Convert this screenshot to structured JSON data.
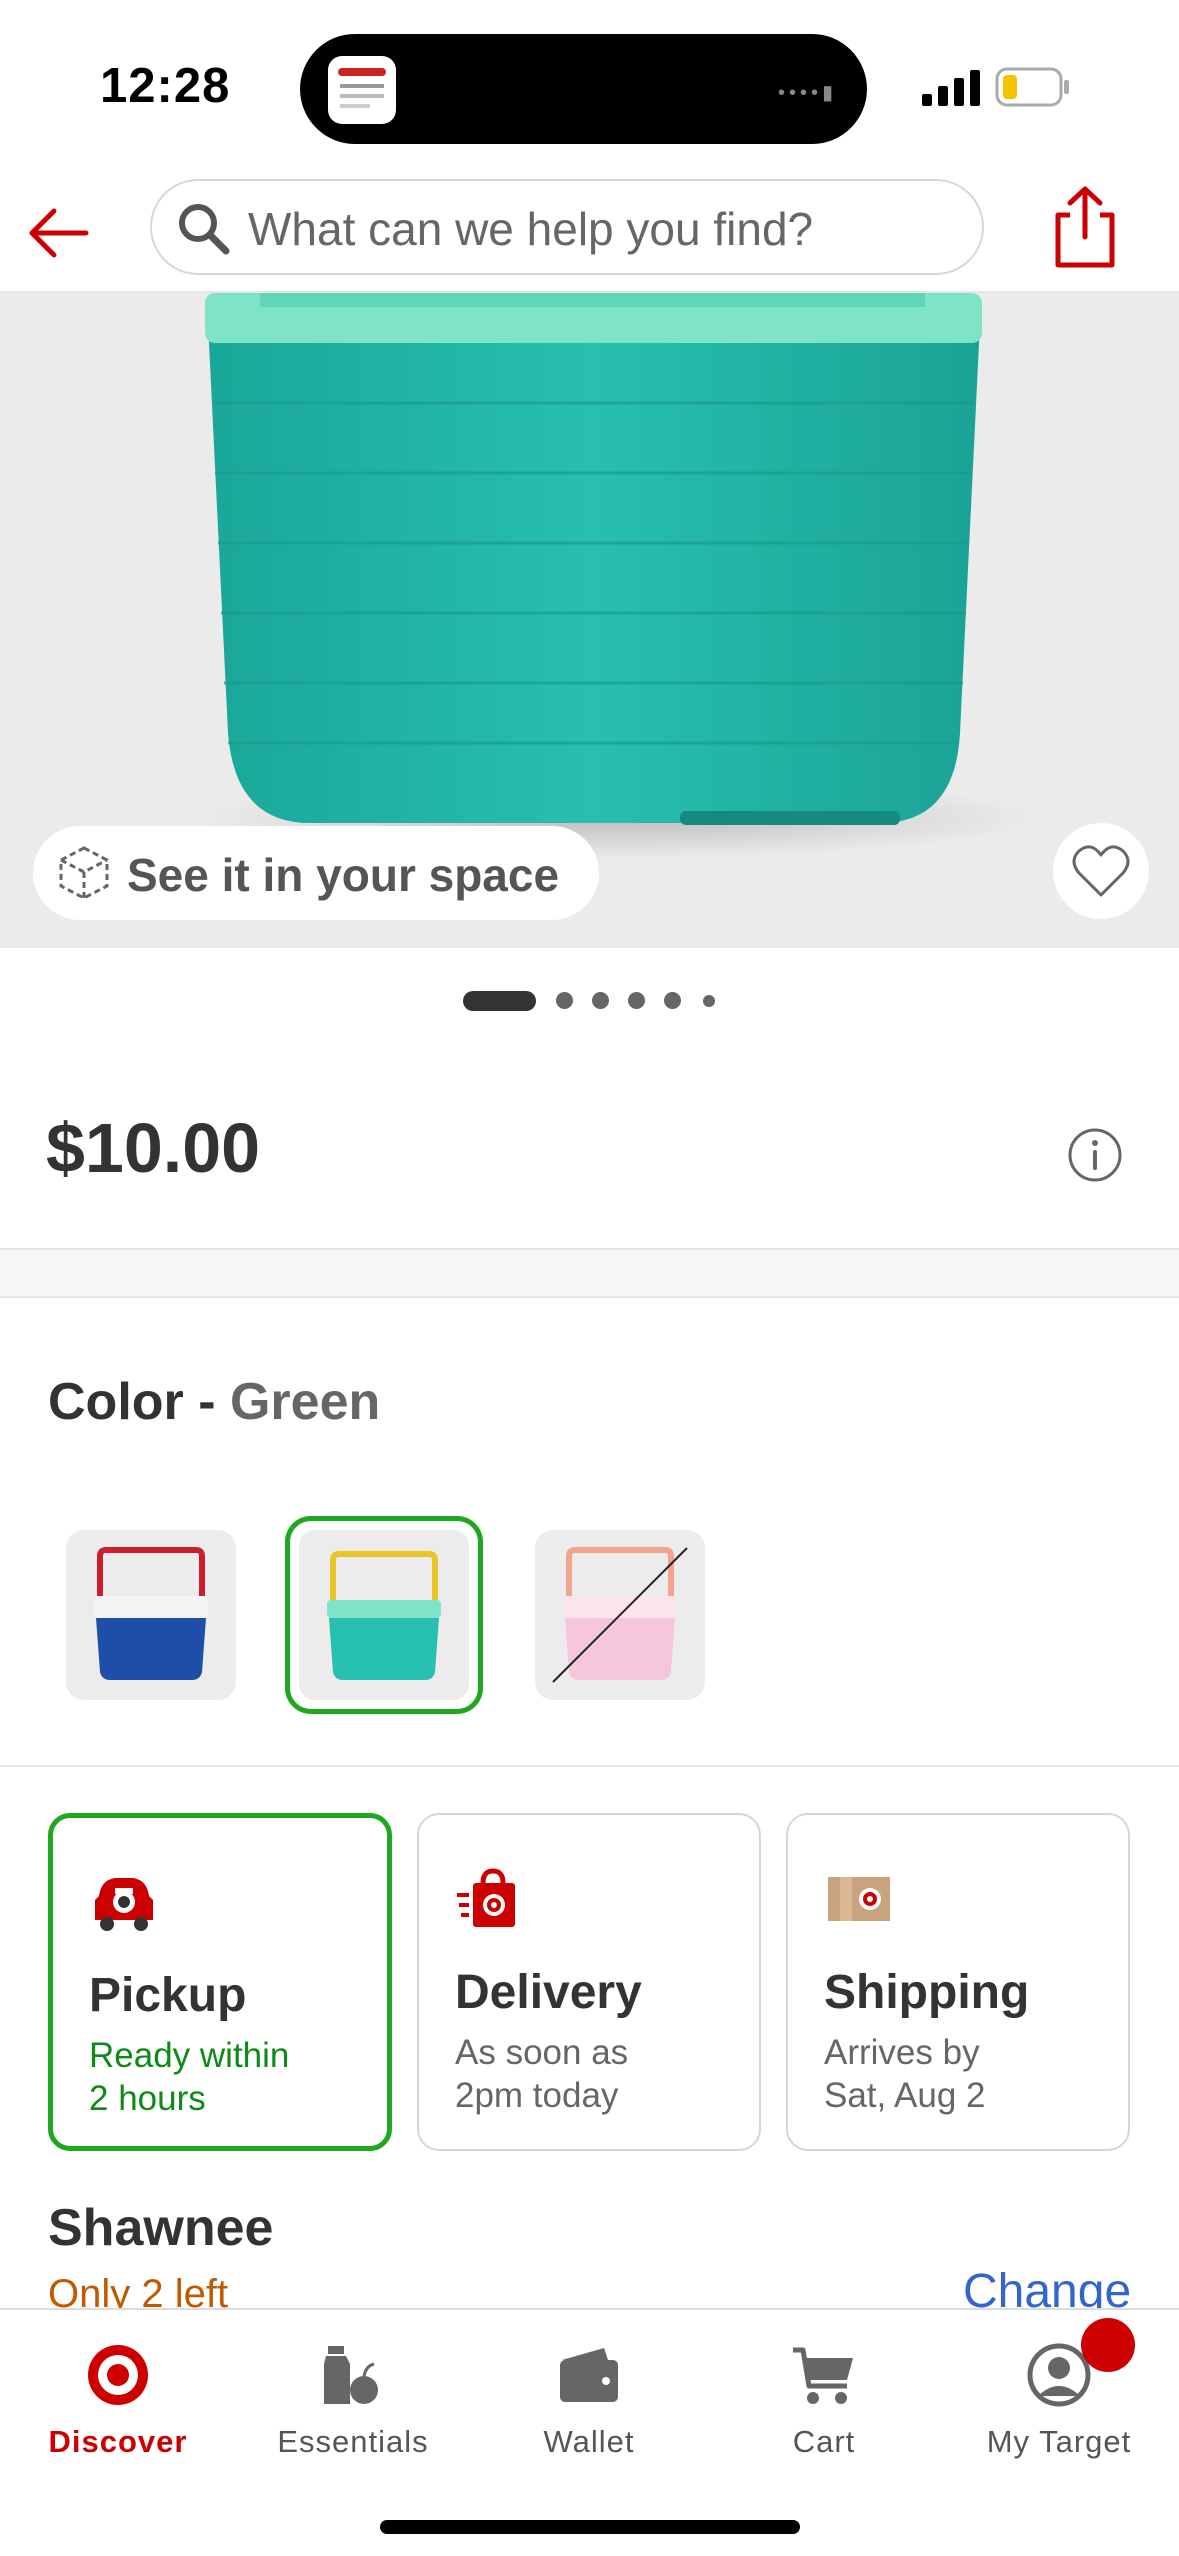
{
  "status_bar": {
    "time": "12:28"
  },
  "search": {
    "placeholder": "What can we help you find?"
  },
  "hero": {
    "ar_label": "See it in your space",
    "image_count": 6,
    "active_image": 1
  },
  "product": {
    "price": "$10.00"
  },
  "color": {
    "label": "Color",
    "separator": " - ",
    "value": "Green",
    "swatches": [
      {
        "name": "Blue",
        "selected": false,
        "available": true
      },
      {
        "name": "Green",
        "selected": true,
        "available": true
      },
      {
        "name": "Pink",
        "selected": false,
        "available": false
      }
    ]
  },
  "fulfillment": {
    "options": [
      {
        "title": "Pickup",
        "line1": "Ready within",
        "line2": "2 hours",
        "selected": true
      },
      {
        "title": "Delivery",
        "line1": "As soon as",
        "line2": "2pm today",
        "selected": false
      },
      {
        "title": "Shipping",
        "line1": "Arrives by",
        "line2": "Sat, Aug 2",
        "selected": false
      }
    ]
  },
  "store": {
    "name": "Shawnee",
    "stock": "Only 2 left",
    "change_label": "Change"
  },
  "tabs": [
    {
      "label": "Discover",
      "icon": "target-bullseye-icon",
      "active": true
    },
    {
      "label": "Essentials",
      "icon": "essentials-icon",
      "active": false
    },
    {
      "label": "Wallet",
      "icon": "wallet-icon",
      "active": false
    },
    {
      "label": "Cart",
      "icon": "cart-icon",
      "active": false
    },
    {
      "label": "My Target",
      "icon": "account-icon",
      "active": false
    }
  ],
  "colors": {
    "brand_red": "#cc0000",
    "selected_green": "#1ea81e",
    "link_blue": "#3366cc",
    "stock_orange": "#c05a00",
    "cooler_teal": "#2bbcae"
  }
}
